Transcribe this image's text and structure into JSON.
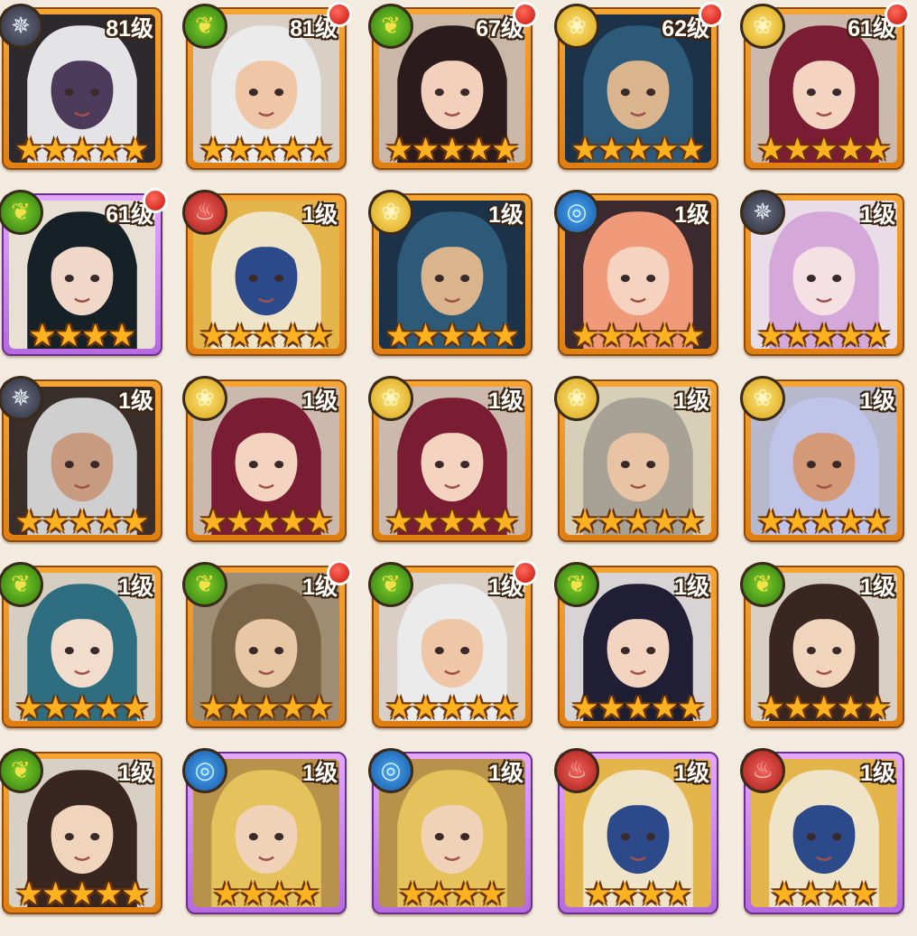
{
  "colors": {
    "background": "#f3ebdf",
    "frame_orange": "#f09a27",
    "frame_purple": "#c883ee",
    "star": "#ffb21f",
    "notify_dot": "#e02a1e"
  },
  "heroes": [
    {
      "level": "81级",
      "faction": "star-icon",
      "frame": "orange",
      "stars": 5,
      "badge": false,
      "art": [
        "#2c2a2e",
        "#e4e3e6",
        "#4b3a5a"
      ]
    },
    {
      "level": "81级",
      "faction": "leaf-icon",
      "frame": "orange",
      "stars": 5,
      "badge": true,
      "art": [
        "#d9cfc4",
        "#ebebec",
        "#f0c7a6"
      ]
    },
    {
      "level": "67级",
      "faction": "leaf-icon",
      "frame": "orange",
      "stars": 5,
      "badge": true,
      "art": [
        "#cbb7a8",
        "#2b1b1d",
        "#f2d0bb"
      ]
    },
    {
      "level": "62级",
      "faction": "flower-icon",
      "frame": "orange",
      "stars": 5,
      "badge": true,
      "art": [
        "#1c3248",
        "#2d5a78",
        "#d9b48c"
      ]
    },
    {
      "level": "61级",
      "faction": "flower-icon",
      "frame": "orange",
      "stars": 5,
      "badge": true,
      "art": [
        "#cbb9ad",
        "#7a1c34",
        "#f4d4c0"
      ]
    },
    {
      "level": "61级",
      "faction": "leaf-icon",
      "frame": "purple",
      "stars": 4,
      "badge": true,
      "art": [
        "#e8e0d5",
        "#152127",
        "#f0d7c8"
      ]
    },
    {
      "level": "1级",
      "faction": "fire-icon",
      "frame": "orange",
      "stars": 5,
      "badge": false,
      "art": [
        "#e3b54a",
        "#f0e4c8",
        "#2c4a8a"
      ]
    },
    {
      "level": "1级",
      "faction": "flower-icon",
      "frame": "orange",
      "stars": 5,
      "badge": false,
      "art": [
        "#1c3248",
        "#2d5a78",
        "#d9b48c"
      ]
    },
    {
      "level": "1级",
      "faction": "water-icon",
      "frame": "orange",
      "stars": 5,
      "badge": false,
      "art": [
        "#3a2a30",
        "#f09a7a",
        "#f6d2c0"
      ]
    },
    {
      "level": "1级",
      "faction": "star-icon",
      "frame": "orange",
      "stars": 5,
      "badge": false,
      "art": [
        "#e9dde8",
        "#d4a8d8",
        "#f5e0e4"
      ]
    },
    {
      "level": "1级",
      "faction": "star-icon",
      "frame": "orange",
      "stars": 5,
      "badge": false,
      "art": [
        "#3a2e2a",
        "#cfcfcf",
        "#c89a80"
      ]
    },
    {
      "level": "1级",
      "faction": "flower-icon",
      "frame": "orange",
      "stars": 5,
      "badge": false,
      "art": [
        "#cbb9ad",
        "#7a1c34",
        "#f4d4c0"
      ]
    },
    {
      "level": "1级",
      "faction": "flower-icon",
      "frame": "orange",
      "stars": 5,
      "badge": false,
      "art": [
        "#cbb9ad",
        "#7a1c34",
        "#f4d4c0"
      ]
    },
    {
      "level": "1级",
      "faction": "flower-icon",
      "frame": "orange",
      "stars": 5,
      "badge": false,
      "art": [
        "#d8cfb8",
        "#a8a296",
        "#e8c4a4"
      ]
    },
    {
      "level": "1级",
      "faction": "flower-icon",
      "frame": "orange",
      "stars": 5,
      "badge": false,
      "art": [
        "#b8b8cc",
        "#c0c4e8",
        "#d49a78"
      ]
    },
    {
      "level": "1级",
      "faction": "leaf-icon",
      "frame": "orange",
      "stars": 5,
      "badge": false,
      "art": [
        "#d6cec0",
        "#2e6e80",
        "#f2dccc"
      ]
    },
    {
      "level": "1级",
      "faction": "leaf-icon",
      "frame": "orange",
      "stars": 5,
      "badge": true,
      "art": [
        "#a08e74",
        "#7a6448",
        "#e8c8a4"
      ]
    },
    {
      "level": "1级",
      "faction": "leaf-icon",
      "frame": "orange",
      "stars": 5,
      "badge": true,
      "art": [
        "#d9cfc4",
        "#ebebec",
        "#f0c7a6"
      ]
    },
    {
      "level": "1级",
      "faction": "leaf-icon",
      "frame": "orange",
      "stars": 5,
      "badge": false,
      "art": [
        "#d8d4d6",
        "#1f1e34",
        "#f2d4c0"
      ]
    },
    {
      "level": "1级",
      "faction": "leaf-icon",
      "frame": "orange",
      "stars": 5,
      "badge": false,
      "art": [
        "#d8d0c4",
        "#3a2620",
        "#f0d4bc"
      ]
    },
    {
      "level": "1级",
      "faction": "leaf-icon",
      "frame": "orange",
      "stars": 5,
      "badge": false,
      "art": [
        "#d8d0c4",
        "#3a2620",
        "#f0d4bc"
      ]
    },
    {
      "level": "1级",
      "faction": "water-icon",
      "frame": "purple",
      "stars": 4,
      "badge": false,
      "art": [
        "#b8924a",
        "#e6c25c",
        "#f0d2b8"
      ]
    },
    {
      "level": "1级",
      "faction": "water-icon",
      "frame": "purple",
      "stars": 4,
      "badge": false,
      "art": [
        "#b8924a",
        "#e6c25c",
        "#f0d2b8"
      ]
    },
    {
      "level": "1级",
      "faction": "fire-icon",
      "frame": "purple",
      "stars": 4,
      "badge": false,
      "art": [
        "#e3b54a",
        "#f0e4c8",
        "#2c4a8a"
      ]
    },
    {
      "level": "1级",
      "faction": "fire-icon",
      "frame": "purple",
      "stars": 4,
      "badge": false,
      "art": [
        "#e3b54a",
        "#f0e4c8",
        "#2c4a8a"
      ]
    }
  ]
}
